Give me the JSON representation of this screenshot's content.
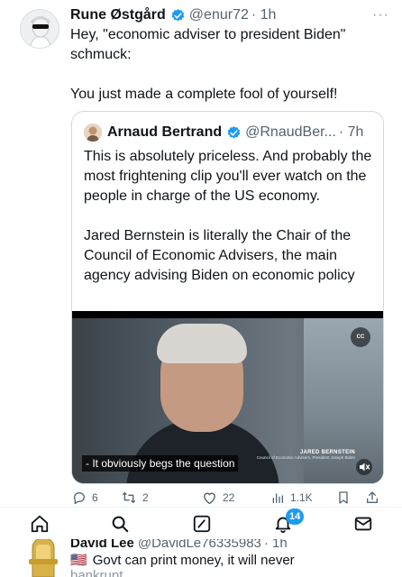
{
  "tweet": {
    "author_name": "Rune Østgård",
    "author_handle": "@enur72",
    "time": "· 1h",
    "more": "···",
    "text_lines": [
      "Hey, \"economic adviser to president Biden\"",
      "schmuck:",
      "You just made a complete fool of yourself!"
    ]
  },
  "quote": {
    "author_name": "Arnaud Bertrand",
    "author_handle": "@RnaudBer...",
    "time": "· 7h",
    "paragraph1": "This is absolutely priceless. And probably the most frightening clip you'll ever watch on the people in charge of the US economy.",
    "paragraph2": "Jared Bernstein is literally the Chair of the Council of Economic Advisers, the main agency advising Biden on economic policy",
    "video": {
      "caption": "- It obviously begs the question",
      "lower_third_name": "JARED BERNSTEIN",
      "lower_third_role": "Council of Economic Advisers, President Joseph Biden",
      "cc_label": "CC"
    }
  },
  "actions": {
    "replies": "6",
    "reposts": "2",
    "likes": "22",
    "views": "1.1K"
  },
  "nav": {
    "notifications_badge": "14",
    "items": [
      "home-icon",
      "search-icon",
      "compose-icon",
      "notifications-icon",
      "messages-icon"
    ]
  },
  "next_tweet": {
    "author_name": "David Lee",
    "author_handle": "@DavidLe76335983",
    "time": "· 1h",
    "flag": "🇺🇸",
    "text": "Govt can print money, it will never",
    "cut_text": "bankrupt"
  },
  "colors": {
    "accent": "#1d9bf0",
    "muted": "#536471",
    "border": "#cfd9de"
  }
}
